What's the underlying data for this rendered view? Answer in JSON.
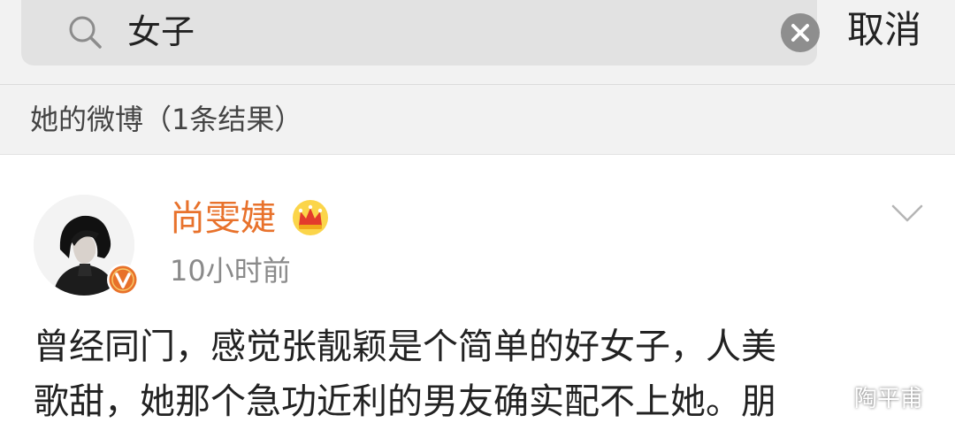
{
  "search": {
    "query": "女子",
    "cancel_label": "取消",
    "icons": [
      "search-icon",
      "clear-icon"
    ]
  },
  "section": {
    "title": "她的微博（1条结果）"
  },
  "post": {
    "username": "尚雯婕",
    "time": "10小时前",
    "lines": [
      "曾经同门，感觉张靓颖是个简单的好女子，人美",
      "歌甜，她那个急功近利的男友确实配不上她。朋"
    ],
    "icons": [
      "avatar",
      "verified-badge-icon",
      "crown-icon",
      "chevron-down-icon"
    ]
  },
  "watermark": {
    "text": "陶平甫"
  },
  "colors": {
    "username": "#e8722c",
    "verified_badge": "#e8712a",
    "crown": "#f3b600",
    "header_background": "#f2f2f2",
    "search_background": "#e2e2e2"
  }
}
